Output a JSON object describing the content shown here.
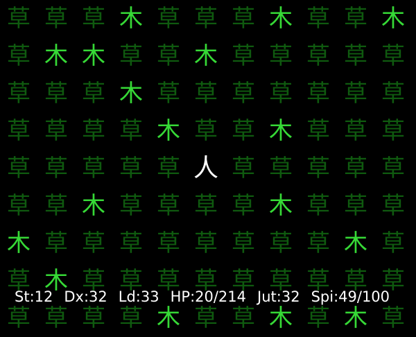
{
  "glyphs": {
    "grass": "草",
    "tree": "木",
    "player": "人"
  },
  "colors": {
    "background": "#000000",
    "grass": "#0f5a0f",
    "tree": "#36d936",
    "player": "#ffffff",
    "status_text": "#ffffff"
  },
  "map": {
    "columns": 11,
    "rows": 9,
    "legend": {
      "g": "grass",
      "t": "tree",
      "p": "player"
    },
    "rows_data": [
      "gggtgggtggt",
      "gttggtggggg",
      "gggtggggggg",
      "ggggtggtggg",
      "gggggpggggg",
      "ggtggggtggg",
      "tggggggggtg",
      "gtggggggggg",
      "ggggtggtgtg"
    ]
  },
  "status": {
    "st": "St:12",
    "dx": "Dx:32",
    "ld": "Ld:33",
    "hp": "HP:20/214",
    "jut": "Jut:32",
    "spi": "Spi:49/100"
  }
}
